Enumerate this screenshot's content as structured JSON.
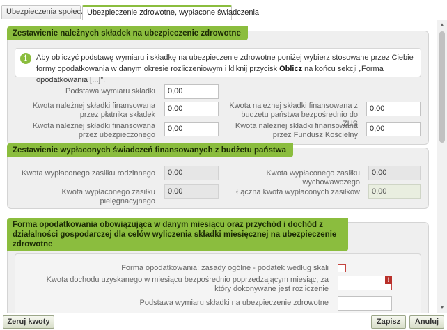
{
  "tabs": [
    {
      "label": "Ubezpieczenia społeczne"
    },
    {
      "label": "Ubezpieczenie zdrowotne, wypłacone świadczenia"
    }
  ],
  "section1": {
    "title": "Zestawienie należnych składek na ubezpieczenie zdrowotne",
    "info_pre": "Aby obliczyć podstawę wymiaru i składkę na ubezpieczenie zdrowotne poniżej wybierz stosowane przez Ciebie formy opodatkowania w danym okresie rozliczeniowym i kliknij przycisk ",
    "info_bold": "Oblicz",
    "info_post": " na końcu sekcji „Forma opodatkowania [...]”.",
    "podstawa_label": "Podstawa wymiaru składki",
    "podstawa_value": "0,00",
    "platnik_label": "Kwota należnej składki finansowana przez płatnika składek",
    "platnik_value": "0,00",
    "budzet_label": "Kwota należnej składki finansowana z budżetu państwa bezpośrednio do ZUS",
    "budzet_value": "0,00",
    "ubezpieczony_label": "Kwota należnej składki finansowana przez ubezpieczonego",
    "ubezpieczony_value": "0,00",
    "fundusz_label": "Kwota należnej składki finansowana przez Fundusz Kościelny",
    "fundusz_value": "0,00"
  },
  "section2": {
    "title": "Zestawienie wypłaconych świadczeń finansowanych z budżetu państwa",
    "rodzinny_label": "Kwota wypłaconego zasiłku rodzinnego",
    "rodzinny_value": "0,00",
    "wychowawczy_label": "Kwota wypłaconego zasiłku wychowawczego",
    "wychowawczy_value": "0,00",
    "pielegnacyjny_label": "Kwota wypłaconego zasiłku pielęgnacyjnego",
    "pielegnacyjny_value": "0,00",
    "laczna_label": "Łączna kwota wypłaconych zasiłków",
    "laczna_value": "0,00"
  },
  "section3": {
    "title": "Forma opodatkowania obowiązująca w danym miesiącu oraz przychód i dochód z działalności gospodarczej dla celów wyliczenia składki miesięcznej na ubezpieczenie zdrowotne",
    "forma_label": "Forma opodatkowania: zasady ogólne - podatek według skali",
    "dochod_label": "Kwota dochodu uzyskanego w miesiącu bezpośrednio poprzedzającym miesiąc, za który dokonywane jest rozliczenie",
    "dochod_value": "",
    "error_marker": "!",
    "podstawa_label": "Podstawa wymiaru składki na ubezpieczenie zdrowotne",
    "podstawa_value": ""
  },
  "buttons": {
    "zeruj": "Zeruj kwoty",
    "zapisz": "Zapisz",
    "anuluj": "Anuluj"
  },
  "colors": {
    "accent": "#8bbd3e",
    "error": "#c4443f"
  }
}
